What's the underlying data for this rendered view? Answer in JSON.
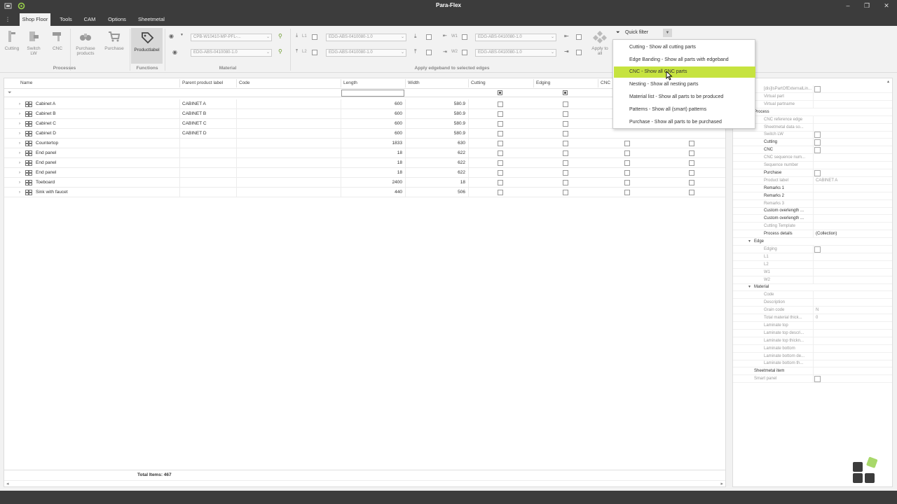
{
  "app": {
    "title": "Para-Flex"
  },
  "menu": {
    "tabs": [
      "Shop Floor",
      "Tools",
      "CAM",
      "Options",
      "Sheetmetal"
    ]
  },
  "ribbon": {
    "buttons": [
      {
        "label": "Cutting"
      },
      {
        "label": "Switch LW"
      },
      {
        "label": "CNC"
      },
      {
        "label": "Purchase products"
      },
      {
        "label": "Purchase"
      },
      {
        "label": "Productlabel"
      }
    ],
    "groups": {
      "processes": "Processes",
      "functions": "Functions",
      "material": "Material",
      "edgeband": "Apply edgeband to selected edges"
    },
    "material_combo_1": "CPB-W10410-MP-PFL-...",
    "material_combo_2": "EDG-ABS-0410080-1.0",
    "edge_l1": "EDG-ABS-0410080-1.0",
    "edge_l2": "EDG-ABS-0410080-1.0",
    "edge_w1": "EDG-ABS-0410080-1.0",
    "edge_w2": "EDG-ABS-0410080-1.0",
    "l1": "L1",
    "l2": "L2",
    "w1": "W1",
    "w2": "W2",
    "apply_to_all": "Apply to all",
    "quick_filter": "Quick filter"
  },
  "quick_filter_items": [
    "Cutting - Show all cutting parts",
    "Edge Banding - Show all parts with edgeband",
    "CNC - Show all CNC parts",
    "Nesting - Show all nesting parts",
    "Material list - Show all parts to be produced",
    "Patterns - Show all (smart) patterns",
    "Purchase - Show all parts to be purchased"
  ],
  "grid": {
    "columns": [
      "Name",
      "Parent product label",
      "Code",
      "Length",
      "Width",
      "Cutting",
      "Edging",
      "CNC"
    ],
    "rows": [
      {
        "name": "Cabinet A",
        "parent": "CABINET A",
        "code": "",
        "length": "600",
        "width": "580.9"
      },
      {
        "name": "Cabinet B",
        "parent": "CABINET B",
        "code": "",
        "length": "600",
        "width": "580.9"
      },
      {
        "name": "Cabinet C",
        "parent": "CABINET C",
        "code": "",
        "length": "600",
        "width": "580.9"
      },
      {
        "name": "Cabinet D",
        "parent": "CABINET D",
        "code": "",
        "length": "600",
        "width": "580.9"
      },
      {
        "name": "Countertop",
        "parent": "",
        "code": "",
        "length": "1833",
        "width": "630"
      },
      {
        "name": "End panel",
        "parent": "",
        "code": "",
        "length": "18",
        "width": "622"
      },
      {
        "name": "End panel",
        "parent": "",
        "code": "",
        "length": "18",
        "width": "622"
      },
      {
        "name": "End panel",
        "parent": "",
        "code": "",
        "length": "18",
        "width": "622"
      },
      {
        "name": "Toeboard",
        "parent": "",
        "code": "",
        "length": "2400",
        "width": "18"
      },
      {
        "name": "Sink with faucet",
        "parent": "",
        "code": "",
        "length": "440",
        "width": "506"
      }
    ],
    "total_items": "Total Items: 467"
  },
  "properties": [
    {
      "label": "[dis]IsPartOfExternalLin...",
      "value": "",
      "type": "check",
      "dark": false
    },
    {
      "label": "Virtual part",
      "value": "",
      "type": "none",
      "dark": false
    },
    {
      "label": "Virtual partname",
      "value": "",
      "type": "none",
      "dark": false
    },
    {
      "label": "Process",
      "value": "",
      "type": "category"
    },
    {
      "label": "CNC reference edge",
      "value": "",
      "type": "none",
      "dark": false
    },
    {
      "label": "Sheetmetal data so...",
      "value": "",
      "type": "none",
      "dark": false
    },
    {
      "label": "Switch LW",
      "value": "",
      "type": "check",
      "dark": false
    },
    {
      "label": "Cutting",
      "value": "",
      "type": "check",
      "dark": true
    },
    {
      "label": "CNC",
      "value": "",
      "type": "check",
      "dark": true
    },
    {
      "label": "CNC sequence num...",
      "value": "",
      "type": "none",
      "dark": false
    },
    {
      "label": "Sequence number",
      "value": "",
      "type": "none",
      "dark": false
    },
    {
      "label": "Purchase",
      "value": "",
      "type": "check",
      "dark": true
    },
    {
      "label": "Product label",
      "value": "CABINET A",
      "type": "text",
      "dark": false
    },
    {
      "label": "Remarks 1",
      "value": "",
      "type": "none",
      "dark": true
    },
    {
      "label": "Remarks 2",
      "value": "",
      "type": "none",
      "dark": true
    },
    {
      "label": "Remarks 3",
      "value": "",
      "type": "none",
      "dark": false
    },
    {
      "label": "Custom overlength ...",
      "value": "",
      "type": "none",
      "dark": true
    },
    {
      "label": "Custom overlength ...",
      "value": "",
      "type": "none",
      "dark": true
    },
    {
      "label": "Cutting Template",
      "value": "",
      "type": "none",
      "dark": false
    },
    {
      "label": "Process details",
      "value": "(Collection)",
      "type": "text",
      "dark": true
    },
    {
      "label": "Edge",
      "value": "",
      "type": "category"
    },
    {
      "label": "Edging",
      "value": "",
      "type": "check",
      "dark": false
    },
    {
      "label": "L1",
      "value": "",
      "type": "none",
      "dark": false
    },
    {
      "label": "L2",
      "value": "",
      "type": "none",
      "dark": false
    },
    {
      "label": "W1",
      "value": "",
      "type": "none",
      "dark": false
    },
    {
      "label": "W2",
      "value": "",
      "type": "none",
      "dark": false
    },
    {
      "label": "Material",
      "value": "",
      "type": "category"
    },
    {
      "label": "Code",
      "value": "",
      "type": "none",
      "dark": false
    },
    {
      "label": "Description",
      "value": "",
      "type": "none",
      "dark": false
    },
    {
      "label": "Grain code",
      "value": "N",
      "type": "text",
      "dark": false
    },
    {
      "label": "Total material thick...",
      "value": "0",
      "type": "text",
      "dark": false
    },
    {
      "label": "Laminate top",
      "value": "",
      "type": "none",
      "dark": false
    },
    {
      "label": "Laminate top descri...",
      "value": "",
      "type": "none",
      "dark": false
    },
    {
      "label": "Laminate top thickn...",
      "value": "",
      "type": "none",
      "dark": false
    },
    {
      "label": "Laminate bottom",
      "value": "",
      "type": "none",
      "dark": false
    },
    {
      "label": "Laminate bottom de...",
      "value": "",
      "type": "none",
      "dark": false
    },
    {
      "label": "Laminate bottom th...",
      "value": "",
      "type": "none",
      "dark": false
    },
    {
      "label": "Sheetmetal item",
      "value": "",
      "type": "toplevel",
      "dark": true
    },
    {
      "label": "Smart panel",
      "value": "",
      "type": "checktop",
      "dark": false
    }
  ],
  "colors": {
    "titlebar": "#3c3c3c",
    "highlight": "#c6e33f",
    "logo_green": "#a8d86a",
    "logo_dark": "#3c3c3c"
  }
}
